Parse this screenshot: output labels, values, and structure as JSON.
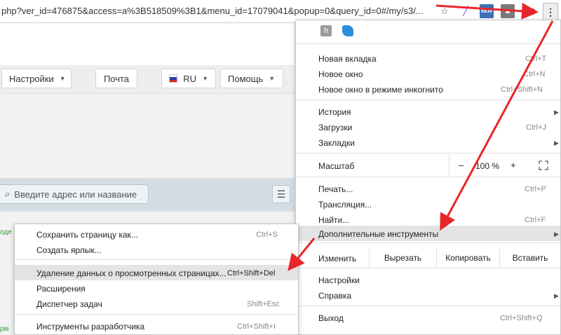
{
  "address_bar": {
    "url": "php?ver_id=476875&access=a%3B518509%3B1&menu_id=17079041&popup=0&query_id=0#/my/s3/...",
    "star_icon": "star-icon",
    "extensions": [
      "feather-icon",
      "new-badge-icon",
      "gray-ext-icon",
      "owl-ext-icon"
    ],
    "new_badge": "NEW",
    "menu_icon": "three-dots-icon",
    "menu_glyph": "⋮"
  },
  "page": {
    "toolbar": {
      "settings_label": "Настройки",
      "mail_label": "Почта",
      "lang_label": "RU",
      "help_label": "Помощь"
    },
    "search": {
      "placeholder": "Введите адрес или название"
    },
    "left_text_1": "оде",
    "left_text_2": "рм"
  },
  "chrome_menu": {
    "ext_letter": "h",
    "items_1": [
      {
        "label": "Новая вкладка",
        "shortcut": "Ctrl+T"
      },
      {
        "label": "Новое окно",
        "shortcut": "Ctrl+N"
      },
      {
        "label": "Новое окно в режиме инкогнито",
        "shortcut": "Ctrl+Shift+N"
      }
    ],
    "items_2": [
      {
        "label": "История",
        "shortcut": ""
      },
      {
        "label": "Загрузки",
        "shortcut": "Ctrl+J"
      },
      {
        "label": "Закладки",
        "shortcut": ""
      }
    ],
    "zoom": {
      "label": "Масштаб",
      "minus": "–",
      "value": "100 %",
      "plus": "+",
      "fullscreen_icon": "fullscreen-icon"
    },
    "items_3": [
      {
        "label": "Печать...",
        "shortcut": "Ctrl+P"
      },
      {
        "label": "Трансляция...",
        "shortcut": ""
      },
      {
        "label": "Найти...",
        "shortcut": "Ctrl+F"
      },
      {
        "label": "Дополнительные инструменты",
        "shortcut": ""
      }
    ],
    "edit": {
      "label": "Изменить",
      "cut": "Вырезать",
      "copy": "Копировать",
      "paste": "Вставить"
    },
    "items_4": [
      {
        "label": "Настройки"
      },
      {
        "label": "Справка"
      }
    ],
    "exit": {
      "label": "Выход",
      "shortcut": "Ctrl+Shift+Q"
    }
  },
  "submenu": {
    "items_1": [
      {
        "label": "Сохранить страницу как...",
        "shortcut": "Ctrl+S"
      },
      {
        "label": "Создать ярлык...",
        "shortcut": ""
      }
    ],
    "items_2": [
      {
        "label": "Удаление данных о просмотренных страницах...",
        "shortcut": "Ctrl+Shift+Del"
      },
      {
        "label": "Расширения",
        "shortcut": ""
      },
      {
        "label": "Диспетчер задач",
        "shortcut": "Shift+Esc"
      }
    ],
    "items_3": [
      {
        "label": "Инструменты разработчика",
        "shortcut": "Ctrl+Shift+I"
      }
    ]
  },
  "colors": {
    "annotation_arrow": "#e8262a",
    "flag_white": "#ffffff",
    "flag_blue": "#1c3fa8",
    "flag_red": "#d52b1e"
  }
}
